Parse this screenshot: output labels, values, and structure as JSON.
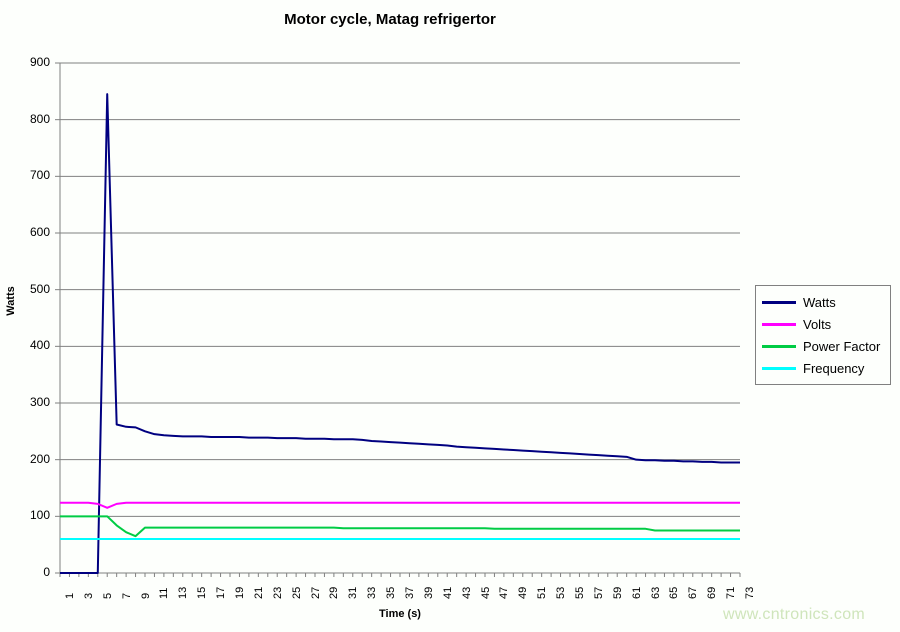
{
  "chart_data": {
    "type": "line",
    "title": "Motor cycle, Matag refrigertor",
    "xlabel": "Time (s)",
    "ylabel": "Watts",
    "ylim": [
      0,
      900
    ],
    "ytick_step": 100,
    "yticks": [
      0,
      100,
      200,
      300,
      400,
      500,
      600,
      700,
      800,
      900
    ],
    "xlim": [
      1,
      73
    ],
    "x": [
      1,
      2,
      3,
      4,
      5,
      6,
      7,
      8,
      9,
      10,
      11,
      12,
      13,
      14,
      15,
      16,
      17,
      18,
      19,
      20,
      21,
      22,
      23,
      24,
      25,
      26,
      27,
      28,
      29,
      30,
      31,
      32,
      33,
      34,
      35,
      36,
      37,
      38,
      39,
      40,
      41,
      42,
      43,
      44,
      45,
      46,
      47,
      48,
      49,
      50,
      51,
      52,
      53,
      54,
      55,
      56,
      57,
      58,
      59,
      60,
      61,
      62,
      63,
      64,
      65,
      66,
      67,
      68,
      69,
      70,
      71,
      72,
      73
    ],
    "xticks": [
      1,
      3,
      5,
      7,
      9,
      11,
      13,
      15,
      17,
      19,
      21,
      23,
      25,
      27,
      29,
      31,
      33,
      35,
      37,
      39,
      41,
      43,
      45,
      47,
      49,
      51,
      53,
      55,
      57,
      59,
      61,
      63,
      65,
      67,
      69,
      71,
      73
    ],
    "grid": "horizontal",
    "legend_position": "right",
    "series": [
      {
        "name": "Watts",
        "color": "#000080",
        "values": [
          0,
          0,
          0,
          0,
          0,
          845,
          262,
          258,
          257,
          250,
          245,
          243,
          242,
          241,
          241,
          241,
          240,
          240,
          240,
          240,
          239,
          239,
          239,
          238,
          238,
          238,
          237,
          237,
          237,
          236,
          236,
          236,
          235,
          233,
          232,
          231,
          230,
          229,
          228,
          227,
          226,
          225,
          223,
          222,
          221,
          220,
          219,
          218,
          217,
          216,
          215,
          214,
          213,
          212,
          211,
          210,
          209,
          208,
          207,
          206,
          205,
          200,
          199,
          199,
          198,
          198,
          197,
          197,
          196,
          196,
          195,
          195,
          195
        ]
      },
      {
        "name": "Volts",
        "color": "#ff00ff",
        "values": [
          124,
          124,
          124,
          124,
          122,
          115,
          122,
          124,
          124,
          124,
          124,
          124,
          124,
          124,
          124,
          124,
          124,
          124,
          124,
          124,
          124,
          124,
          124,
          124,
          124,
          124,
          124,
          124,
          124,
          124,
          124,
          124,
          124,
          124,
          124,
          124,
          124,
          124,
          124,
          124,
          124,
          124,
          124,
          124,
          124,
          124,
          124,
          124,
          124,
          124,
          124,
          124,
          124,
          124,
          124,
          124,
          124,
          124,
          124,
          124,
          124,
          124,
          124,
          124,
          124,
          124,
          124,
          124,
          124,
          124,
          124,
          124,
          124
        ]
      },
      {
        "name": "Power Factor",
        "color": "#00cc44",
        "values": [
          100,
          100,
          100,
          100,
          100,
          100,
          84,
          72,
          65,
          80,
          80,
          80,
          80,
          80,
          80,
          80,
          80,
          80,
          80,
          80,
          80,
          80,
          80,
          80,
          80,
          80,
          80,
          80,
          80,
          80,
          79,
          79,
          79,
          79,
          79,
          79,
          79,
          79,
          79,
          79,
          79,
          79,
          79,
          79,
          79,
          79,
          78,
          78,
          78,
          78,
          78,
          78,
          78,
          78,
          78,
          78,
          78,
          78,
          78,
          78,
          78,
          78,
          78,
          75,
          75,
          75,
          75,
          75,
          75,
          75,
          75,
          75,
          75
        ]
      },
      {
        "name": "Frequency",
        "color": "#00ffff",
        "values": [
          60,
          60,
          60,
          60,
          60,
          60,
          60,
          60,
          60,
          60,
          60,
          60,
          60,
          60,
          60,
          60,
          60,
          60,
          60,
          60,
          60,
          60,
          60,
          60,
          60,
          60,
          60,
          60,
          60,
          60,
          60,
          60,
          60,
          60,
          60,
          60,
          60,
          60,
          60,
          60,
          60,
          60,
          60,
          60,
          60,
          60,
          60,
          60,
          60,
          60,
          60,
          60,
          60,
          60,
          60,
          60,
          60,
          60,
          60,
          60,
          60,
          60,
          60,
          60,
          60,
          60,
          60,
          60,
          60,
          60,
          60,
          60,
          60
        ]
      }
    ]
  },
  "legend": {
    "items": [
      {
        "label": "Watts",
        "color": "#000080"
      },
      {
        "label": "Volts",
        "color": "#ff00ff"
      },
      {
        "label": "Power Factor",
        "color": "#00cc44"
      },
      {
        "label": "Frequency",
        "color": "#00ffff"
      }
    ]
  },
  "watermark": {
    "text": "www.cntronics.com",
    "color": "#cfe5bb"
  },
  "colors": {
    "axis": "#808080",
    "gridline": "#808080",
    "background": "#fdfffc",
    "text": "#000000"
  }
}
